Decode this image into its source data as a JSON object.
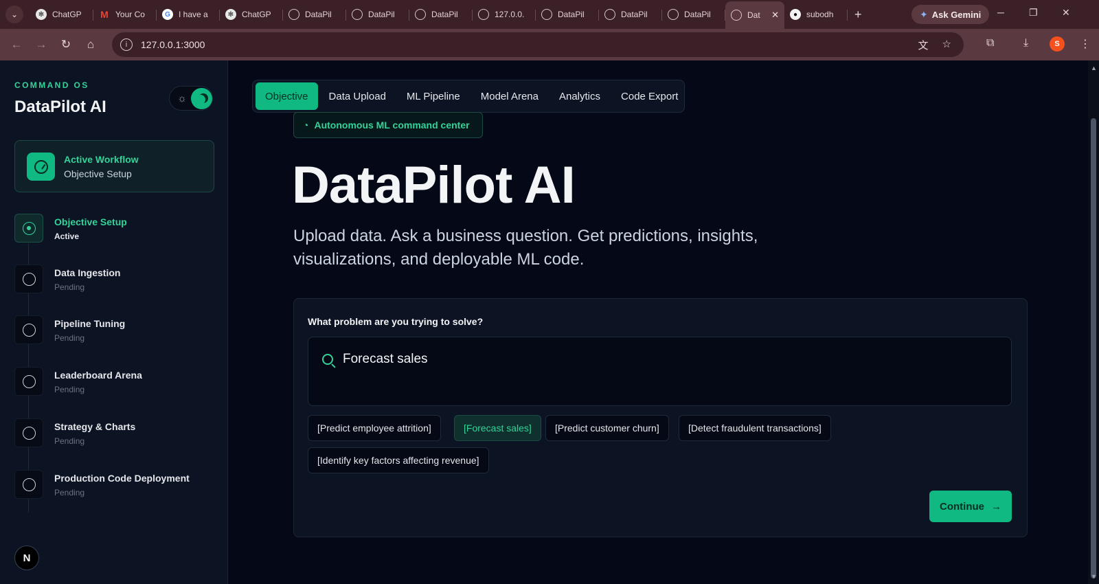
{
  "browser": {
    "tabs": [
      {
        "label": "ChatGP",
        "icon": "chatgpt-icon"
      },
      {
        "label": "Your Co",
        "icon": "gmail-icon"
      },
      {
        "label": "I have a",
        "icon": "google-icon"
      },
      {
        "label": "ChatGP",
        "icon": "chatgpt-icon"
      },
      {
        "label": "DataPil",
        "icon": "globe-icon"
      },
      {
        "label": "DataPil",
        "icon": "globe-icon"
      },
      {
        "label": "DataPil",
        "icon": "globe-icon"
      },
      {
        "label": "127.0.0.",
        "icon": "globe-icon"
      },
      {
        "label": "DataPil",
        "icon": "globe-icon"
      },
      {
        "label": "DataPil",
        "icon": "globe-icon"
      },
      {
        "label": "DataPil",
        "icon": "globe-icon"
      },
      {
        "label": "Dat",
        "icon": "globe-icon",
        "active": true
      },
      {
        "label": "subodh",
        "icon": "github-icon"
      }
    ],
    "ask_gemini": "Ask Gemini",
    "url": "127.0.0.1:3000",
    "profile_initial": "S"
  },
  "sidebar": {
    "kicker": "COMMAND OS",
    "title": "DataPilot AI",
    "workflow": {
      "title": "Active Workflow",
      "subtitle": "Objective Setup"
    },
    "steps": [
      {
        "title": "Objective Setup",
        "status": "Active"
      },
      {
        "title": "Data Ingestion",
        "status": "Pending"
      },
      {
        "title": "Pipeline Tuning",
        "status": "Pending"
      },
      {
        "title": "Leaderboard Arena",
        "status": "Pending"
      },
      {
        "title": "Strategy & Charts",
        "status": "Pending"
      },
      {
        "title": "Production Code Deployment",
        "status": "Pending"
      }
    ],
    "footer_badge": "N"
  },
  "nav": {
    "tabs": [
      "Objective",
      "Data Upload",
      "ML Pipeline",
      "Model Arena",
      "Analytics",
      "Code Export"
    ],
    "active": "Objective"
  },
  "hero": {
    "chip": "Autonomous ML command center",
    "title": "DataPilot AI",
    "subtitle": "Upload data. Ask a business question. Get predictions, insights, visualizations, and deployable ML code."
  },
  "objective": {
    "question": "What problem are you trying to solve?",
    "query_value": "Forecast sales",
    "suggestions": [
      "[Predict employee attrition]",
      "[Forecast sales]",
      "[Predict customer churn]",
      "[Detect fraudulent transactions]",
      "[Identify key factors affecting revenue]"
    ],
    "selected_suggestion": "[Forecast sales]",
    "continue_label": "Continue"
  },
  "colors": {
    "accent": "#10b981",
    "accent_text": "#34d399",
    "background": "#050816",
    "panel": "#0c1424",
    "browser_frame": "#5b3940"
  }
}
